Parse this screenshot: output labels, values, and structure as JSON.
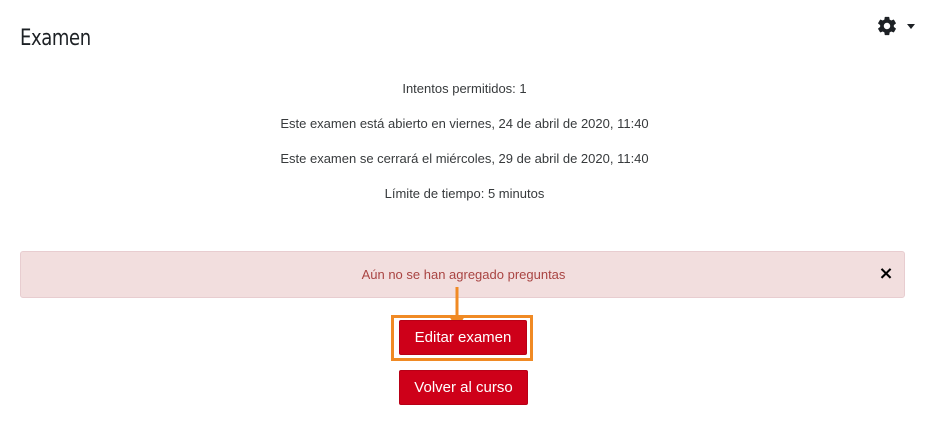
{
  "page": {
    "title": "Examen"
  },
  "header": {
    "settings_icon": "gear-icon",
    "dropdown_icon": "caret-down-icon"
  },
  "quiz_info": {
    "attempts": "Intentos permitidos: 1",
    "opens": "Este examen está abierto en viernes, 24 de abril de 2020, 11:40",
    "closes": "Este examen se cerrará el miércoles, 29 de abril de 2020, 11:40",
    "time_limit": "Límite de tiempo: 5 minutos"
  },
  "alert": {
    "message": "Aún no se han agregado preguntas",
    "close_label": "×"
  },
  "buttons": {
    "edit_quiz": "Editar examen",
    "back_to_course": "Volver al curso"
  },
  "colors": {
    "primary": "#ce0019",
    "alert_bg": "#f2dede",
    "alert_text": "#a94442",
    "annotation": "#f08a24"
  }
}
